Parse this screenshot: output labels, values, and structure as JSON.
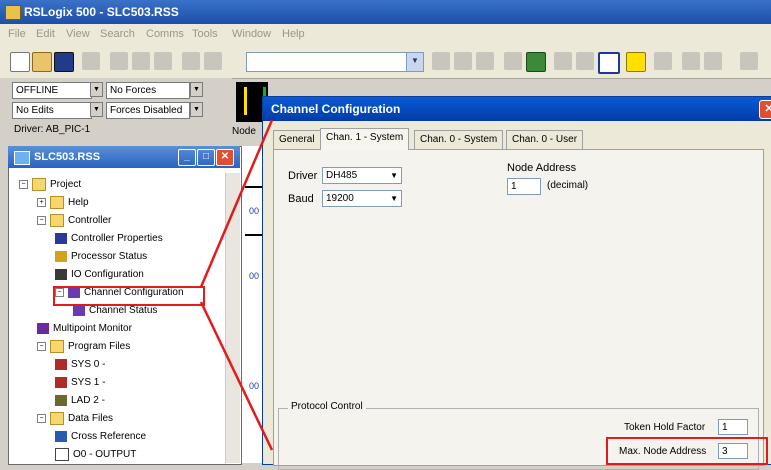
{
  "app": {
    "title": "RSLogix 500 - SLC503.RSS"
  },
  "menu": [
    "File",
    "Edit",
    "View",
    "Search",
    "Comms",
    "Tools",
    "Window",
    "Help"
  ],
  "status": {
    "mode": "OFFLINE",
    "forces": "No Forces",
    "edits": "No Edits",
    "forces_enabled": "Forces Disabled",
    "driver": "Driver: AB_PIC-1",
    "node_prefix": "Node"
  },
  "project_window": {
    "title": "SLC503.RSS",
    "tree": [
      {
        "label": "Project",
        "indent": 0,
        "expander": "−",
        "icon": "folder-icon"
      },
      {
        "label": "Help",
        "indent": 1,
        "expander": "+",
        "icon": "folder-icon"
      },
      {
        "label": "Controller",
        "indent": 1,
        "expander": "−",
        "icon": "folder-icon"
      },
      {
        "label": "Controller Properties",
        "indent": 2,
        "expander": "",
        "icon": "info-icon"
      },
      {
        "label": "Processor Status",
        "indent": 2,
        "expander": "",
        "icon": "status-icon"
      },
      {
        "label": "IO Configuration",
        "indent": 2,
        "expander": "",
        "icon": "io-icon"
      },
      {
        "label": "Channel Configuration",
        "indent": 2,
        "expander": "−",
        "icon": "channel-icon"
      },
      {
        "label": "Channel Status",
        "indent": 3,
        "expander": "",
        "icon": "channel-icon"
      },
      {
        "label": "Multipoint Monitor",
        "indent": 1,
        "expander": "",
        "icon": "monitor-icon"
      },
      {
        "label": "Program Files",
        "indent": 1,
        "expander": "−",
        "icon": "folder-icon"
      },
      {
        "label": "SYS 0 -",
        "indent": 2,
        "expander": "",
        "icon": "sysfile-icon"
      },
      {
        "label": "SYS 1 -",
        "indent": 2,
        "expander": "",
        "icon": "sysfile-icon"
      },
      {
        "label": "LAD 2 -",
        "indent": 2,
        "expander": "",
        "icon": "ladder-icon"
      },
      {
        "label": "Data Files",
        "indent": 1,
        "expander": "−",
        "icon": "folder-icon"
      },
      {
        "label": "Cross Reference",
        "indent": 2,
        "expander": "",
        "icon": "crossref-icon"
      },
      {
        "label": "O0 - OUTPUT",
        "indent": 2,
        "expander": "",
        "icon": "datafile-icon"
      }
    ]
  },
  "ladder": {
    "rung_labels": [
      "00",
      "00",
      "00"
    ]
  },
  "dialog": {
    "title": "Channel Configuration",
    "tabs": [
      "General",
      "Chan. 1 - System",
      "Chan. 0 - System",
      "Chan. 0 - User"
    ],
    "driver_label": "Driver",
    "driver_value": "DH485",
    "baud_label": "Baud",
    "baud_value": "19200",
    "node_address_label": "Node Address",
    "node_address_value": "1",
    "node_address_unit": "(decimal)",
    "protocol_group": "Protocol Control",
    "token_hold_label": "Token Hold Factor",
    "token_hold_value": "1",
    "max_node_label": "Max. Node Address",
    "max_node_value": "3"
  },
  "colors": {
    "highlight": "#e21b1b",
    "title_blue": "#0a5ad4"
  }
}
